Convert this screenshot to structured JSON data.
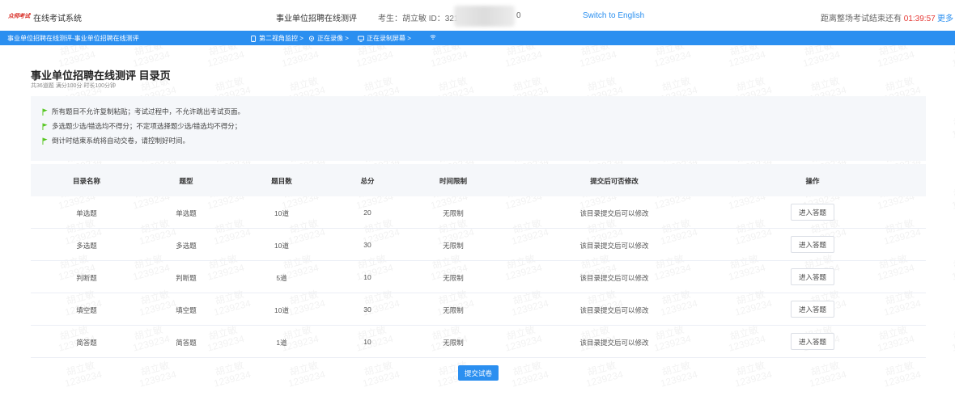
{
  "header": {
    "logo_text": "众师考试",
    "system_name": "在线考试系统",
    "exam_title": "事业单位招聘在线测评",
    "candidate": "考生：胡立敏  ID：321",
    "candidate_id_tail": "0",
    "language_switch": "Switch to English",
    "countdown_label": "距离整场考试结束还有",
    "countdown_time": "01:39:57",
    "more_label": "更多"
  },
  "status_bar": {
    "breadcrumb": "事业单位招聘在线测评-事业单位招聘在线测评",
    "items": [
      {
        "icon": "phone-icon",
        "label": "第二视角监控 >"
      },
      {
        "icon": "camera-icon",
        "label": "正在录像 >"
      },
      {
        "icon": "monitor-icon",
        "label": "正在录制屏幕 >"
      },
      {
        "icon": "wifi-icon",
        "label": ""
      }
    ]
  },
  "page": {
    "title": "事业单位招聘在线测评 目录页",
    "subtitle": "共36道题 满分100分 时长100分钟"
  },
  "notice": {
    "flag_color": "#52c41a",
    "lines": [
      "所有题目不允许复制粘贴；考试过程中，不允许跳出考试页面。",
      "多选题少选/错选均不得分；不定项选择题少选/错选均不得分；",
      "倒计时结束系统将自动交卷，请控制好时间。"
    ]
  },
  "table": {
    "columns": [
      "目录名称",
      "题型",
      "题目数",
      "总分",
      "时间限制",
      "提交后可否修改",
      "操作"
    ],
    "rows": [
      {
        "name": "单选题",
        "type": "单选题",
        "count": "10道",
        "score": "20",
        "time_limit": "无限制",
        "modifiable": "该目录提交后可以修改",
        "action": "进入答题"
      },
      {
        "name": "多选题",
        "type": "多选题",
        "count": "10道",
        "score": "30",
        "time_limit": "无限制",
        "modifiable": "该目录提交后可以修改",
        "action": "进入答题"
      },
      {
        "name": "判断题",
        "type": "判断题",
        "count": "5道",
        "score": "10",
        "time_limit": "无限制",
        "modifiable": "该目录提交后可以修改",
        "action": "进入答题"
      },
      {
        "name": "填空题",
        "type": "填空题",
        "count": "10道",
        "score": "30",
        "time_limit": "无限制",
        "modifiable": "该目录提交后可以修改",
        "action": "进入答题"
      },
      {
        "name": "简答题",
        "type": "简答题",
        "count": "1道",
        "score": "10",
        "time_limit": "无限制",
        "modifiable": "该目录提交后可以修改",
        "action": "进入答题"
      }
    ]
  },
  "submit_label": "提交试卷",
  "watermark": {
    "name": "胡立敏",
    "id": "1239234"
  },
  "colors": {
    "accent": "#2b8ff0",
    "danger": "#e53935"
  }
}
